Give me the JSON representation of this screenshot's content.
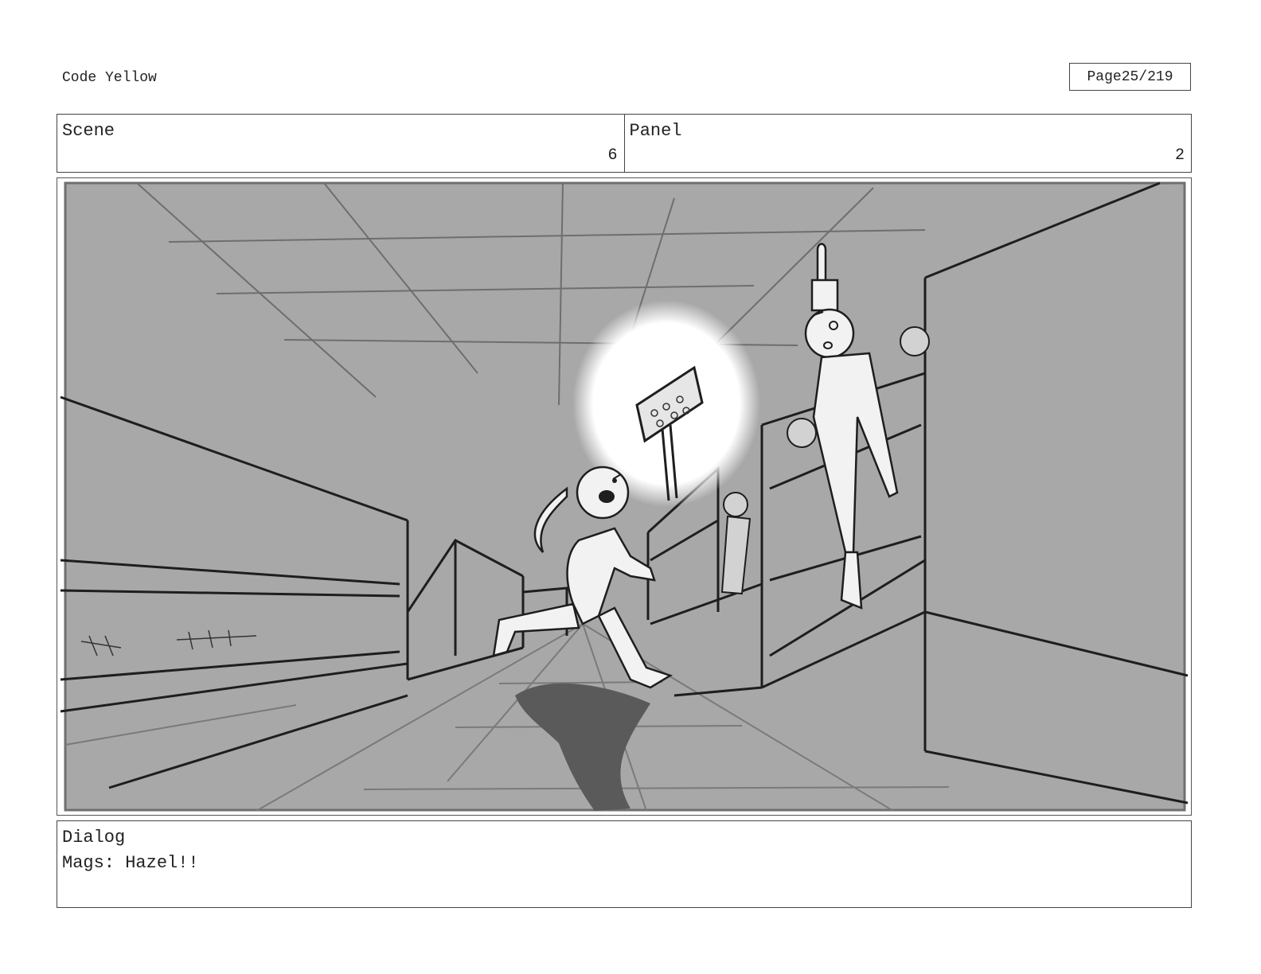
{
  "document": {
    "title": "Code Yellow",
    "page_label": "Page",
    "page_number": "25/219"
  },
  "header": {
    "scene_label": "Scene",
    "scene_value": "6",
    "panel_label": "Panel",
    "panel_value": "2"
  },
  "dialog": {
    "label": "Dialog",
    "text": "Mags: Hazel!!"
  },
  "colors": {
    "panel_fill": "#a8a8a8",
    "line": "#1e1e1e",
    "shadow": "#5a5a5a",
    "glow": "#ffffff"
  }
}
